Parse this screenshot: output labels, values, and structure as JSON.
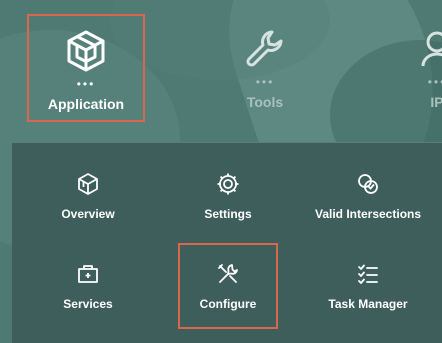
{
  "top_nav": {
    "items": [
      {
        "label": "Application",
        "icon": "cube-network-icon",
        "selected": true
      },
      {
        "label": "Tools",
        "icon": "wrench-icon",
        "selected": false
      },
      {
        "label": "IP",
        "icon": "person-badge-icon",
        "selected": false
      }
    ]
  },
  "menu": {
    "tiles": [
      {
        "label": "Overview",
        "icon": "cube-icon"
      },
      {
        "label": "Settings",
        "icon": "gear-icon"
      },
      {
        "label": "Valid Intersections",
        "icon": "intersect-check-icon"
      },
      {
        "label": "Services",
        "icon": "toolbox-icon"
      },
      {
        "label": "Configure",
        "icon": "tools-icon",
        "selected": true
      },
      {
        "label": "Task Manager",
        "icon": "checklist-icon"
      }
    ]
  },
  "colors": {
    "background": "#4f7a74",
    "panel": "#3e5e5c",
    "selection_border": "#d9674d",
    "text": "#ffffff"
  }
}
